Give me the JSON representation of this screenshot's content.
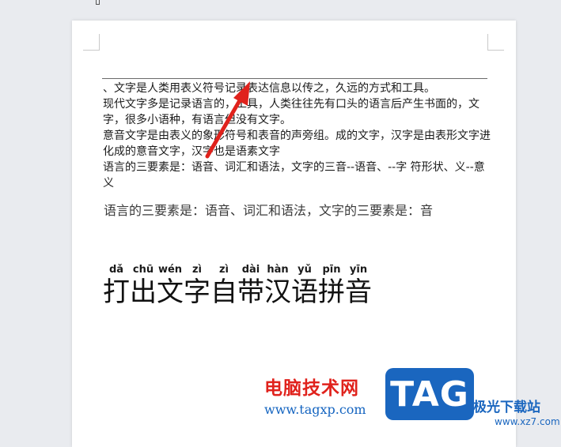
{
  "document": {
    "lines": [
      "、文字是人类用表义符号记录表达信息以传之，久远的方式和工具。",
      "现代文字多是记录语言的，工具，人类往往先有口头的语言后产生书面的，文字，很多小语种，有语言但没有文字。",
      "意音文字是由表义的象形符号和表音的声旁组。成的文字，汉字是由表形文字进化成的意音文字，汉字也是语素文字",
      "语言的三要素是：语音、词汇和语法，文字的三音--语音、--字  符形状、义--意义"
    ],
    "serif_line": "语言的三要素是：语音、词汇和语法，文字的三要素是：音",
    "pinyin_title": [
      {
        "py": "dǎ",
        "hz": "打"
      },
      {
        "py": "chū",
        "hz": "出"
      },
      {
        "py": "wén",
        "hz": "文"
      },
      {
        "py": "zì",
        "hz": "字"
      },
      {
        "py": "zì",
        "hz": "自"
      },
      {
        "py": "dài",
        "hz": "带"
      },
      {
        "py": "hàn",
        "hz": "汉"
      },
      {
        "py": "yǔ",
        "hz": "语"
      },
      {
        "py": "pīn",
        "hz": "拼"
      },
      {
        "py": "yīn",
        "hz": "音"
      }
    ]
  },
  "watermark": {
    "site_name": "电脑技术网",
    "site_url": "www.tagxp.com",
    "badge": "TAG",
    "right_title": "极光下载站",
    "right_url": "www.xz7.com"
  },
  "colors": {
    "arrow": "#e0221c",
    "badge_bg": "#1a66bf",
    "site_name": "#e0221c",
    "site_url": "#1464c0"
  }
}
